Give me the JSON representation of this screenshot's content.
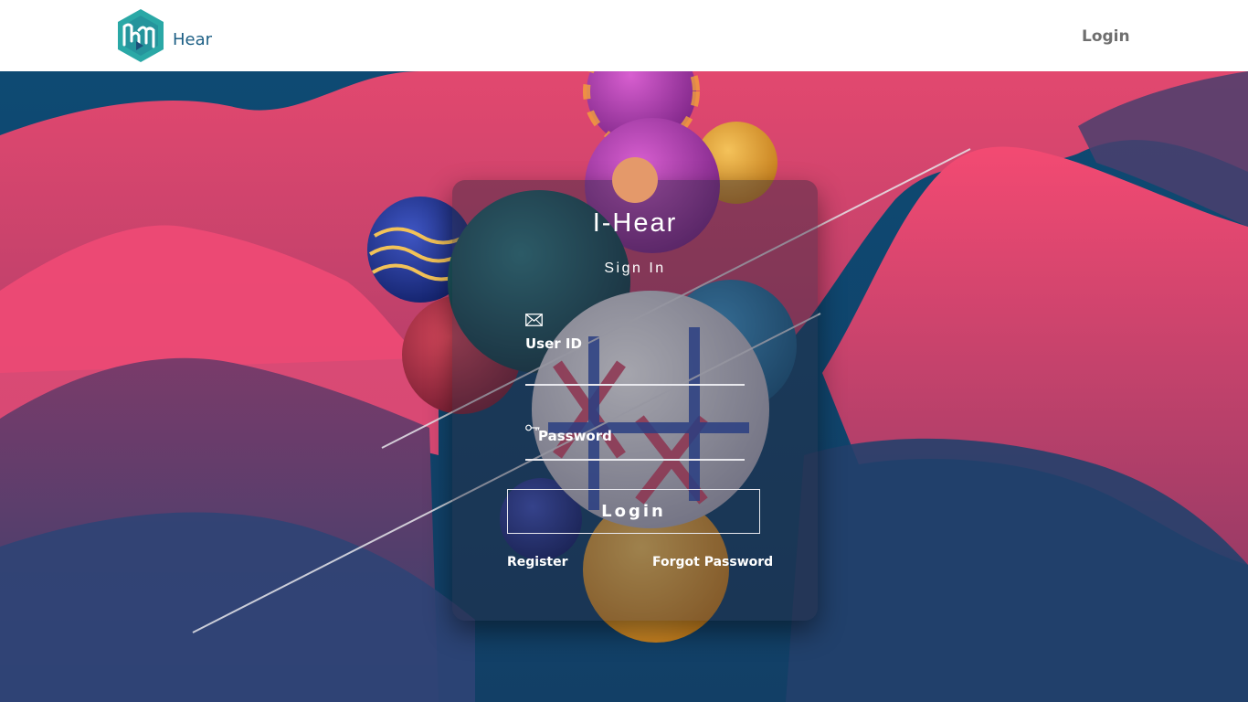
{
  "header": {
    "brand_name": "Hear",
    "nav_login": "Login",
    "logo_color": "#2aa8a6"
  },
  "login_card": {
    "title": "I-Hear",
    "subtitle": "Sign In",
    "user_id_label": "User ID",
    "user_id_value": "",
    "user_id_icon": "envelope-icon",
    "password_label": "Password",
    "password_value": "",
    "password_icon": "key-icon",
    "submit_label": "Login",
    "register_label": "Register",
    "forgot_label": "Forgot Password",
    "avatar_color": "#e4996a"
  },
  "colors": {
    "accent_pink": "#f04a76",
    "background_navy": "#0f3f66"
  }
}
